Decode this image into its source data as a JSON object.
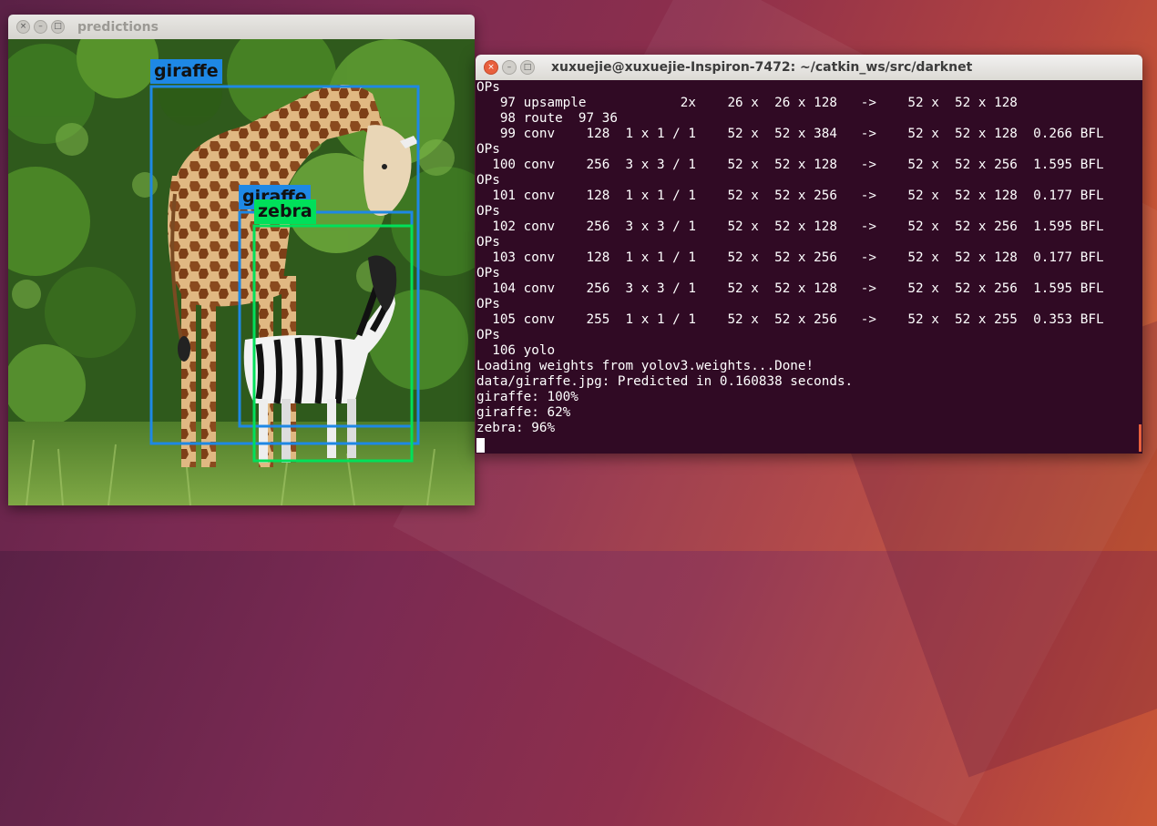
{
  "predictions_window": {
    "title": "predictions",
    "controls": [
      "close",
      "minimize",
      "maximize"
    ],
    "detections": [
      {
        "label": "giraffe",
        "color": "#1e88e5"
      },
      {
        "label": "giraffe",
        "color": "#1e88e5"
      },
      {
        "label": "zebra",
        "color": "#00e05a"
      }
    ]
  },
  "terminal_window": {
    "title": "xuxuejie@xuxuejie-Inspiron-7472: ~/catkin_ws/src/darknet",
    "controls": [
      "close",
      "minimize",
      "maximize"
    ],
    "lines": [
      "OPs",
      "   97 upsample            2x    26 x  26 x 128   ->    52 x  52 x 128",
      "   98 route  97 36",
      "   99 conv    128  1 x 1 / 1    52 x  52 x 384   ->    52 x  52 x 128  0.266 BFL",
      "OPs",
      "  100 conv    256  3 x 3 / 1    52 x  52 x 128   ->    52 x  52 x 256  1.595 BFL",
      "OPs",
      "  101 conv    128  1 x 1 / 1    52 x  52 x 256   ->    52 x  52 x 128  0.177 BFL",
      "OPs",
      "  102 conv    256  3 x 3 / 1    52 x  52 x 128   ->    52 x  52 x 256  1.595 BFL",
      "OPs",
      "  103 conv    128  1 x 1 / 1    52 x  52 x 256   ->    52 x  52 x 128  0.177 BFL",
      "OPs",
      "  104 conv    256  3 x 3 / 1    52 x  52 x 128   ->    52 x  52 x 256  1.595 BFL",
      "OPs",
      "  105 conv    255  1 x 1 / 1    52 x  52 x 256   ->    52 x  52 x 255  0.353 BFL",
      "OPs",
      "  106 yolo",
      "Loading weights from yolov3.weights...Done!",
      "data/giraffe.jpg: Predicted in 0.160838 seconds.",
      "giraffe: 100%",
      "giraffe: 62%",
      "zebra: 96%"
    ],
    "background": "#300a24"
  }
}
